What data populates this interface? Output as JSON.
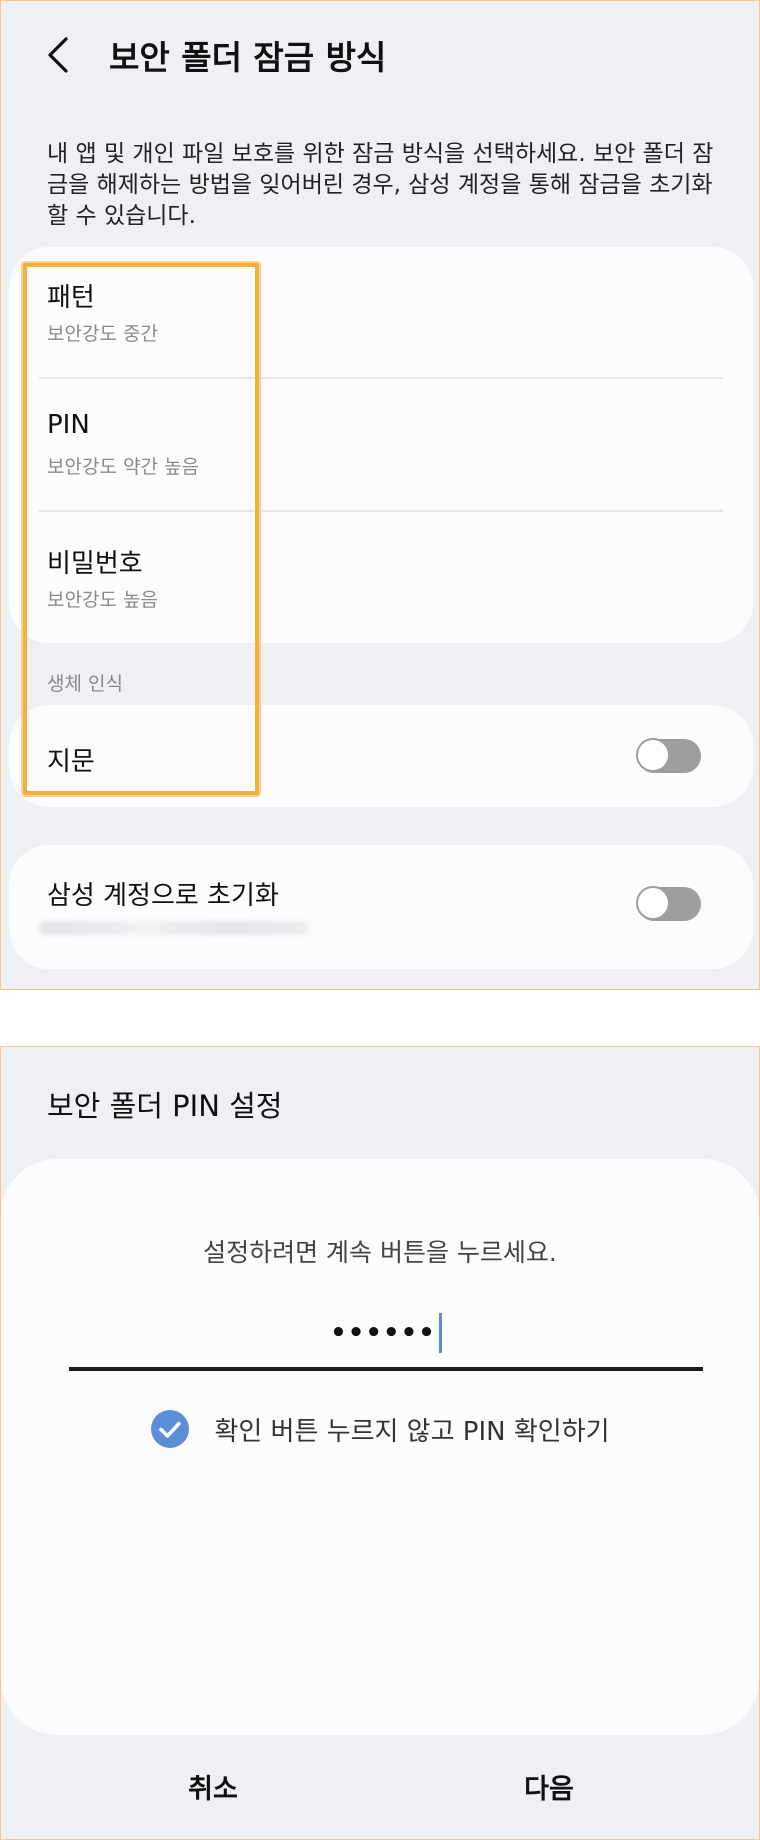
{
  "lock_screen": {
    "title": "보안 폴더 잠금 방식",
    "description": "내 앱 및 개인 파일 보호를 위한 잠금 방식을 선택하세요. 보안 폴더 잠금을 해제하는 방법을 잊어버린 경우, 삼성 계정을 통해 잠금을 초기화할 수 있습니다.",
    "methods": [
      {
        "label": "패턴",
        "strength": "보안강도 중간"
      },
      {
        "label": "PIN",
        "strength": "보안강도 약간 높음"
      },
      {
        "label": "비밀번호",
        "strength": "보안강도 높음"
      }
    ],
    "biometrics_section": "생체 인식",
    "fingerprint": {
      "label": "지문",
      "enabled": false
    },
    "samsung_reset": {
      "label": "삼성 계정으로 초기화",
      "enabled": false
    }
  },
  "pin_dialog": {
    "title": "보안 폴더 PIN 설정",
    "instruction": "설정하려면 계속 버튼을 누르세요.",
    "pin_value": "••••••",
    "checkbox": {
      "label": "확인 버튼 누르지 않고 PIN 확인하기",
      "checked": true
    },
    "cancel_label": "취소",
    "next_label": "다음"
  },
  "colors": {
    "background": "#eef0f4",
    "card": "#fcfcfc",
    "accent_blue": "#5b8ed8",
    "highlight": "#f2b040",
    "toggle_off": "#9e9e9e"
  },
  "icons": {
    "back": "chevron-left-icon",
    "checkbox": "check-circle-icon"
  }
}
